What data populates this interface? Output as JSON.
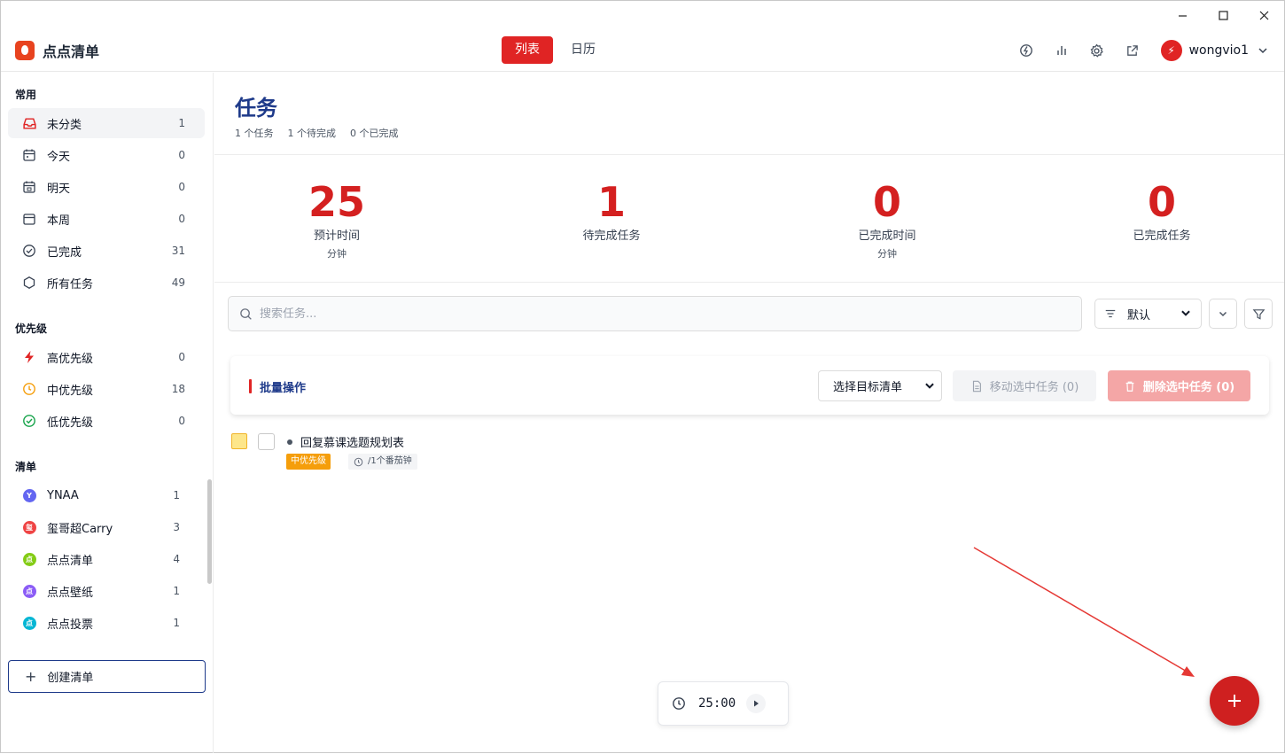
{
  "window": {
    "controls": [
      "minimize",
      "maximize",
      "close"
    ]
  },
  "app": {
    "name": "点点清单"
  },
  "view_tabs": [
    {
      "label": "列表",
      "active": true
    },
    {
      "label": "日历",
      "active": false
    }
  ],
  "header_icons": [
    "theme-icon",
    "stats-icon",
    "settings-icon",
    "external-link-icon"
  ],
  "user": {
    "name": "wongvio1"
  },
  "sidebar": {
    "common_title": "常用",
    "common": [
      {
        "label": "未分类",
        "count": "1",
        "icon": "inbox-icon",
        "active": true
      },
      {
        "label": "今天",
        "count": "0",
        "icon": "calendar-icon"
      },
      {
        "label": "明天",
        "count": "0",
        "icon": "calendar-next-icon"
      },
      {
        "label": "本周",
        "count": "0",
        "icon": "calendar-week-icon"
      },
      {
        "label": "已完成",
        "count": "31",
        "icon": "check-circle-icon"
      },
      {
        "label": "所有任务",
        "count": "49",
        "icon": "hexagon-icon"
      }
    ],
    "priority_title": "优先级",
    "priority": [
      {
        "label": "高优先级",
        "count": "0",
        "icon": "lightning-icon",
        "color": "#e02424"
      },
      {
        "label": "中优先级",
        "count": "18",
        "icon": "clock-icon",
        "color": "#f59e0b"
      },
      {
        "label": "低优先级",
        "count": "0",
        "icon": "check-circle-icon",
        "color": "#16a34a"
      }
    ],
    "lists_title": "清单",
    "lists": [
      {
        "label": "YNAA",
        "count": "1",
        "badge": "Y",
        "color": "#6366f1"
      },
      {
        "label": "玺哥超Carry",
        "count": "3",
        "badge": "玺",
        "color": "#ef4444"
      },
      {
        "label": "点点清单",
        "count": "4",
        "badge": "点",
        "color": "#84cc16"
      },
      {
        "label": "点点壁纸",
        "count": "1",
        "badge": "点",
        "color": "#8b5cf6"
      },
      {
        "label": "点点投票",
        "count": "1",
        "badge": "点",
        "color": "#06b6d4"
      }
    ],
    "create_label": "创建清单"
  },
  "page": {
    "title": "任务",
    "meta": [
      "1 个任务",
      "1 个待完成",
      "0 个已完成"
    ]
  },
  "stats": [
    {
      "value": "25",
      "label": "预计时间",
      "unit": "分钟"
    },
    {
      "value": "1",
      "label": "待完成任务",
      "unit": ""
    },
    {
      "value": "0",
      "label": "已完成时间",
      "unit": "分钟"
    },
    {
      "value": "0",
      "label": "已完成任务",
      "unit": ""
    }
  ],
  "search": {
    "placeholder": "搜索任务..."
  },
  "sort": {
    "selected": "默认"
  },
  "batch": {
    "title": "批量操作",
    "target_placeholder": "选择目标清单",
    "move_label": "移动选中任务 (0)",
    "delete_label": "删除选中任务 (0)"
  },
  "tasks": [
    {
      "name": "回复慕课选题规划表",
      "priority": "中优先级",
      "pomodoro": "/1个番茄钟"
    }
  ],
  "timer": {
    "value": "25:00"
  },
  "colors": {
    "accent": "#e02424",
    "title": "#1e3a8a",
    "priority_medium": "#f59e0b"
  }
}
